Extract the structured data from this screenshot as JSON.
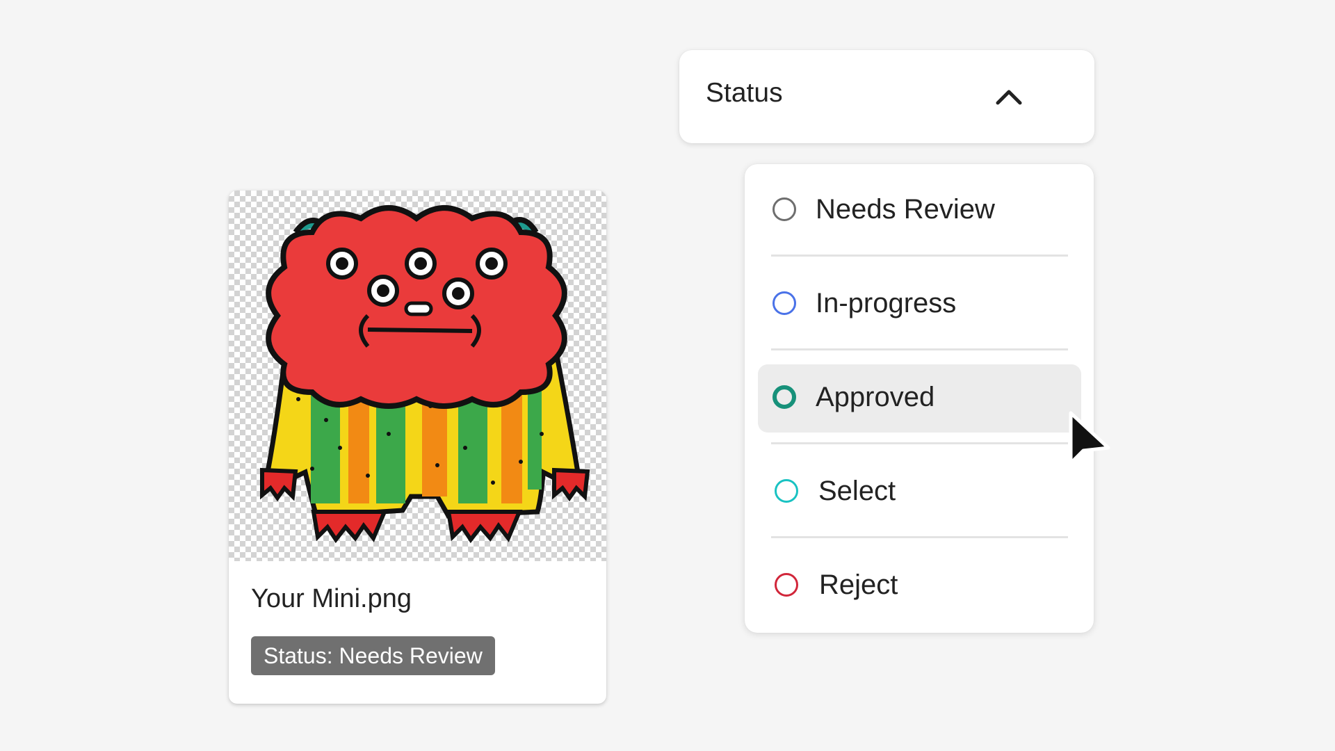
{
  "asset": {
    "file_name": "Your Mini.png",
    "status_badge": "Status: Needs Review",
    "thumbnail_icon": "monster-illustration"
  },
  "dropdown": {
    "label": "Status",
    "chevron_icon": "chevron-up-icon",
    "expanded": true,
    "options": [
      {
        "label": "Needs Review",
        "color": "#6e6e6e",
        "highlighted": false
      },
      {
        "label": "In-progress",
        "color": "#4a72e8",
        "highlighted": false
      },
      {
        "label": "Approved",
        "color": "#17917a",
        "highlighted": true
      },
      {
        "label": "Select",
        "color": "#19c2c2",
        "highlighted": false
      },
      {
        "label": "Reject",
        "color": "#d1263a",
        "highlighted": false
      }
    ]
  },
  "cursor_icon": "arrow-cursor-icon"
}
